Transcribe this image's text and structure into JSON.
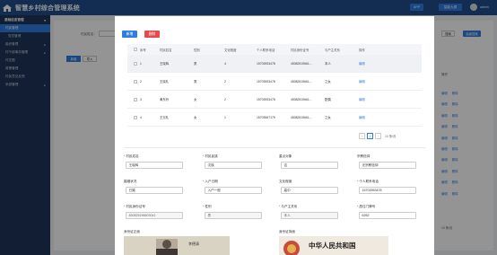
{
  "app": {
    "title": "智慧乡村综合管理系统",
    "top_buttons": [
      "APP",
      "智能大屏"
    ],
    "user_name": "admin"
  },
  "sidebar": {
    "items": [
      {
        "label": "基础信息管理",
        "type": "group",
        "arrow": "▾"
      },
      {
        "label": "村民管理",
        "type": "active"
      },
      {
        "label": "党员管理",
        "type": "sub"
      },
      {
        "label": "组织管理",
        "type": "item",
        "arrow": "▸"
      },
      {
        "label": "村干部事务管理",
        "type": "item",
        "arrow": "▸"
      },
      {
        "label": "村庄图",
        "type": "item"
      },
      {
        "label": "政策管理",
        "type": "item"
      },
      {
        "label": "村民意见反馈",
        "type": "item"
      },
      {
        "label": "系统管理",
        "type": "item",
        "arrow": "▸"
      }
    ]
  },
  "background": {
    "filter_label": "村民姓名：",
    "buttons": [
      "搜索",
      "高级搜索"
    ],
    "tags": [
      "新增",
      "导入"
    ],
    "ops_header": "操作",
    "op_links": [
      "编辑",
      "删除"
    ],
    "pager_text": "10 条/页"
  },
  "modal": {
    "add_button": "新增",
    "delete_button": "删除",
    "table": {
      "headers": [
        "",
        "序号",
        "村民姓名",
        "性别",
        "文化程度",
        "个人联系电话",
        "村民身份证号",
        "与户主关系",
        "操作"
      ],
      "rows": [
        [
          "1",
          "王晓辉",
          "男",
          "4",
          "15703953478",
          "45082519661...",
          "本人",
          "编辑"
        ],
        [
          "2",
          "王晓礼",
          "男",
          "2",
          "15703953478",
          "45082519661...",
          "之女",
          "编辑"
        ],
        [
          "3",
          "黄东玲",
          "女",
          "2",
          "15703953478",
          "45082519661...",
          "配偶",
          "编辑"
        ],
        [
          "4",
          "王兄礼",
          "女",
          "1",
          "15703567179",
          "45082519661...",
          "之女",
          "编辑"
        ]
      ]
    },
    "pager": {
      "prev": "‹",
      "page": "1",
      "next": "›",
      "size": "10 条/页"
    },
    "form": {
      "fields": [
        {
          "label": "村民姓名",
          "required": true,
          "value": "王晓辉",
          "disabled": false
        },
        {
          "label": "村民民族",
          "required": true,
          "value": "汉族",
          "disabled": false
        },
        {
          "label": "重点对象",
          "required": false,
          "value": "否",
          "disabled": false
        },
        {
          "label": "宗教信仰",
          "required": false,
          "value": "无宗教信仰",
          "disabled": false
        },
        {
          "label": "婚姻状况",
          "required": false,
          "value": "已婚",
          "disabled": false
        },
        {
          "label": "入户日期",
          "required": true,
          "value": "入户一般",
          "disabled": false
        },
        {
          "label": "文化程度",
          "required": false,
          "value": "高中",
          "disabled": false
        },
        {
          "label": "个人联系电话",
          "required": true,
          "value": "15703953478",
          "disabled": false
        },
        {
          "label": "村民身份证号",
          "required": true,
          "value": "450825196603041",
          "disabled": true
        },
        {
          "label": "性别",
          "required": true,
          "value": "男",
          "disabled": true
        },
        {
          "label": "与户主关系",
          "required": true,
          "value": "本人",
          "disabled": true
        },
        {
          "label": "居住门牌号",
          "required": true,
          "value": "6262",
          "disabled": false
        }
      ],
      "photo_front_label": "身份证正面",
      "photo_back_label": "身份证背面",
      "id_back_text": "中华人民共和国",
      "id_front_name": "李德清"
    }
  },
  "colors": {
    "header_bg": "#1f4e8c",
    "sidebar_bg": "#1e3558",
    "accent": "#2f7de1",
    "danger": "#e5484d"
  }
}
